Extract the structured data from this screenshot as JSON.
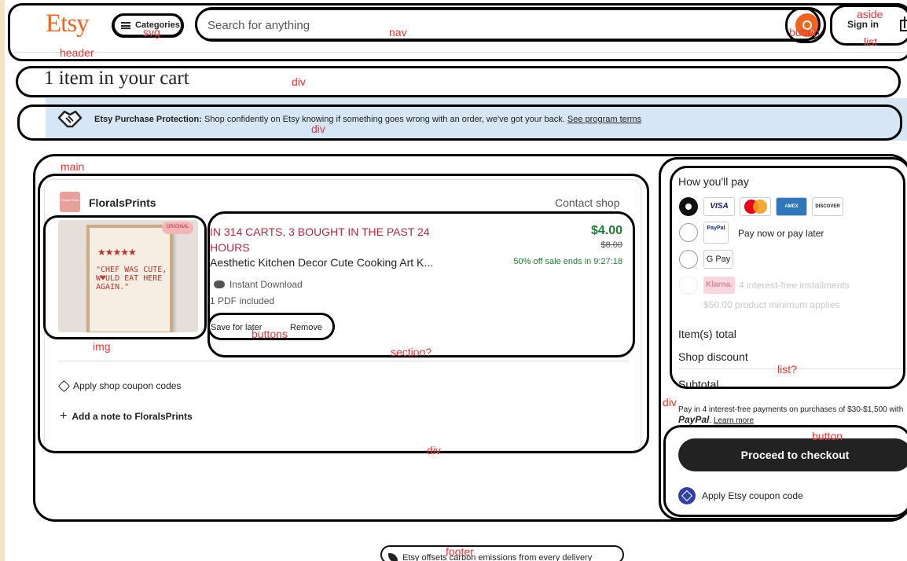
{
  "header": {
    "logo": "Etsy",
    "categories_label": "Categories",
    "search_placeholder": "Search for anything",
    "sign_in_label": "Sign in"
  },
  "cart": {
    "title": "1 item in your cart"
  },
  "banner": {
    "bold": "Etsy Purchase Protection:",
    "text": " Shop confidently on Etsy knowing if something goes wrong with an order, we've got your back. ",
    "link": "See program terms"
  },
  "shop": {
    "name": "FloralsPrints",
    "avatar_text": "Florals Prints",
    "contact_label": "Contact shop"
  },
  "item": {
    "image_badge": "ORIGINAL",
    "image_stars": "★★★★★",
    "image_quote": "\"CHEF WAS CUTE, W♥ULD EAT HERE AGAIN.\"",
    "carts_notice": "IN 314 CARTS, 3 BOUGHT IN THE PAST 24 HOURS",
    "title": "Aesthetic Kitchen Decor Cute Cooking Art K...",
    "delivery": "Instant Download",
    "files": "1 PDF included",
    "save_label": "Save for later",
    "remove_label": "Remove",
    "price": "$4.00",
    "original_price": "$8.00",
    "sale_notice": "50% off sale ends in 9:27:18"
  },
  "card_actions": {
    "coupon": "Apply shop coupon codes",
    "note": "Add a note to FloralsPrints"
  },
  "payment": {
    "heading": "How you'll pay",
    "cards": [
      "VISA",
      "",
      "AMEX",
      "DISCOVER"
    ],
    "paypal_label": "Pay now or pay later",
    "paypal_icon": "PayPal",
    "gpay_label": "G Pay",
    "klarna_icon": "Klarna.",
    "klarna_label": "4 interest-free installments",
    "klarna_sub": "$50.00 product minimum applies"
  },
  "summary": {
    "items_total": "Item(s) total",
    "shop_discount": "Shop discount",
    "subtotal": "Subtotal"
  },
  "paypal_promo": {
    "text": "Pay in 4 interest-free payments on purchases of $30-$1,500 with ",
    "brand": "PayPal",
    "link": "Learn more"
  },
  "checkout": {
    "button_label": "Proceed to checkout",
    "coupon_label": "Apply Etsy coupon code"
  },
  "footer": {
    "text": "Etsy offsets carbon emissions from every delivery"
  },
  "annotations": {
    "header": "header",
    "svg": "svg",
    "nav": "nav",
    "button": "button",
    "aside": "aside",
    "list": "list",
    "div_title": "div",
    "div_banner": "div",
    "main": "main",
    "img": "img",
    "buttons": "buttons",
    "section": "section?",
    "div_card": "div",
    "div_side": "div",
    "list_side": "list?",
    "button_side": "button",
    "footer": "footer"
  },
  "colors": {
    "brand": "#f1641e",
    "sale_green": "#1e7d32",
    "notice_red": "#b52b3a",
    "banner_bg": "#d7e6f5",
    "checkout_bg": "#222222"
  }
}
